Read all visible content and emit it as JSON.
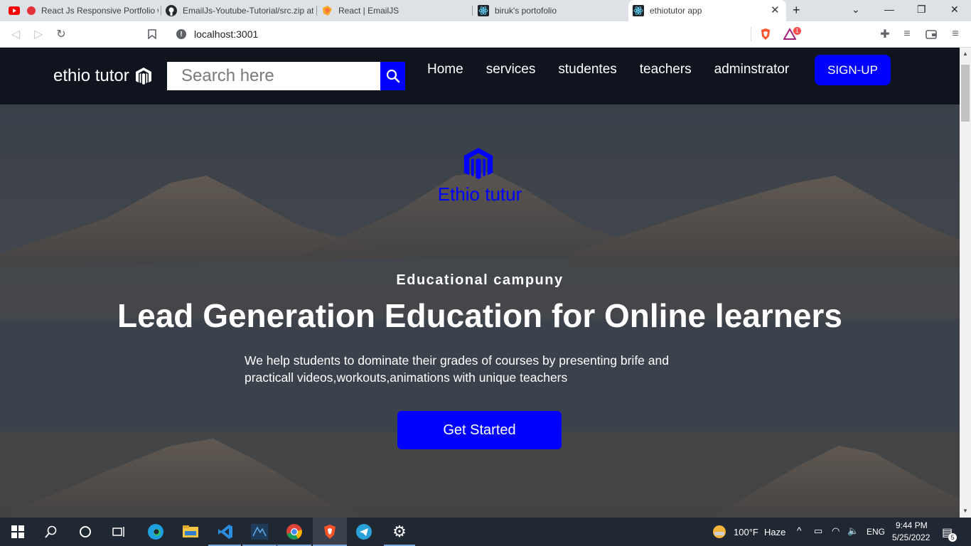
{
  "browser": {
    "tabs": [
      {
        "label": "React Js Responsive Portfolio w",
        "icon": "youtube-icon",
        "active": false
      },
      {
        "label": "EmailJs-Youtube-Tutorial/src.zip at",
        "icon": "github-icon",
        "active": false
      },
      {
        "label": "React | EmailJS",
        "icon": "emailjs-icon",
        "active": false
      },
      {
        "label": "biruk's portofolio",
        "icon": "react-icon",
        "active": false
      },
      {
        "label": "ethiotutor app",
        "icon": "react-icon",
        "active": true
      }
    ],
    "url": "localhost:3001",
    "brave_badge": "1"
  },
  "nav": {
    "brand": "ethio tutor",
    "search_placeholder": "Search here",
    "links": [
      "Home",
      "services",
      "studentes",
      "teachers",
      "adminstrator"
    ],
    "signup_label": "SIGN-UP"
  },
  "hero": {
    "logo_text": "Ethio tutur",
    "eyebrow": "Educational campuny",
    "headline": "Lead Generation Education for Online learners",
    "lead": "We help students to dominate their grades of courses by presenting brife and practicall videos,workouts,animations with unique teachers",
    "cta_label": "Get Started"
  },
  "taskbar": {
    "weather_temp": "100°F",
    "weather_desc": "Haze",
    "language": "ENG",
    "time": "9:44 PM",
    "date": "5/25/2022",
    "notifications": "5"
  },
  "colors": {
    "accent": "#0000ff",
    "nav_bg": "#0f141e",
    "taskbar_bg": "#202833"
  }
}
